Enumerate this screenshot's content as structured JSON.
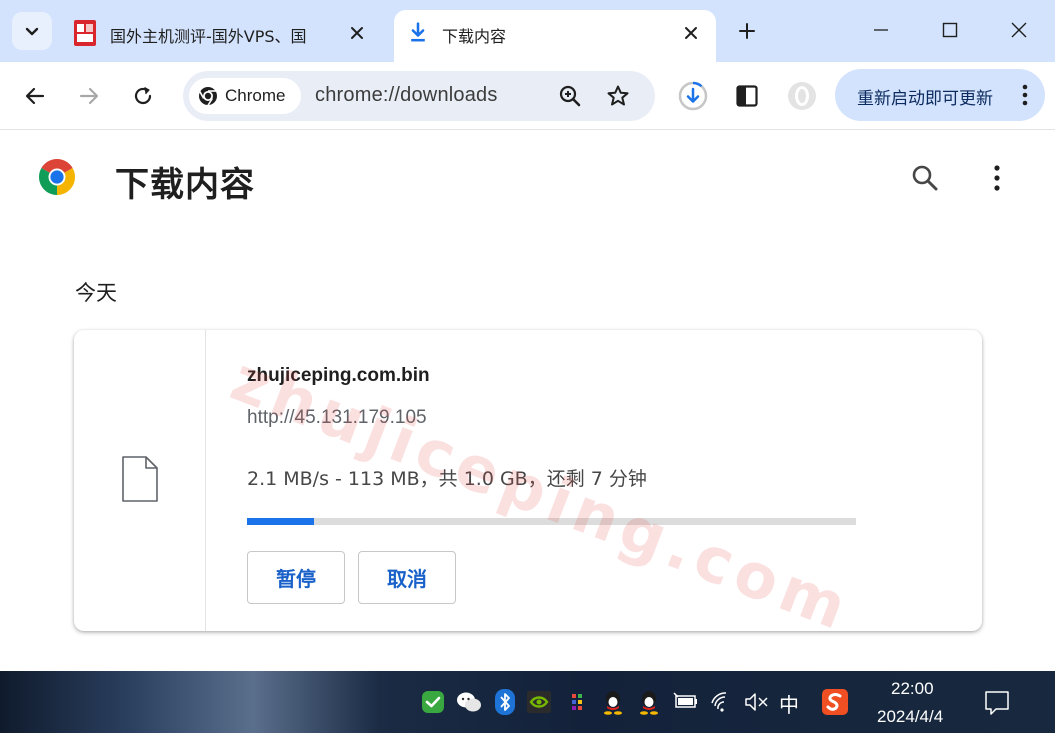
{
  "tabs": [
    {
      "title": "国外主机测评-国外VPS、国",
      "active": false
    },
    {
      "title": "下载内容",
      "active": true
    }
  ],
  "omnibox": {
    "chip_label": "Chrome",
    "url": "chrome://downloads"
  },
  "toolbar": {
    "update_label": "重新启动即可更新"
  },
  "page": {
    "title": "下载内容",
    "section_label": "今天"
  },
  "download": {
    "file_name": "zhujiceping.com.bin",
    "source_url": "http://45.131.179.105",
    "status": "2.1 MB/s - 113 MB，共 1.0 GB，还剩 7 分钟",
    "progress_fraction": 0.11,
    "pause_label": "暂停",
    "cancel_label": "取消"
  },
  "watermark": "zhujiceping.com",
  "taskbar": {
    "ime_label": "中",
    "time": "22:00",
    "date": "2024/4/4"
  },
  "colors": {
    "tabstrip": "#d3e3fd",
    "accent": "#1a73e8",
    "update_button": "#d3e3fd"
  }
}
